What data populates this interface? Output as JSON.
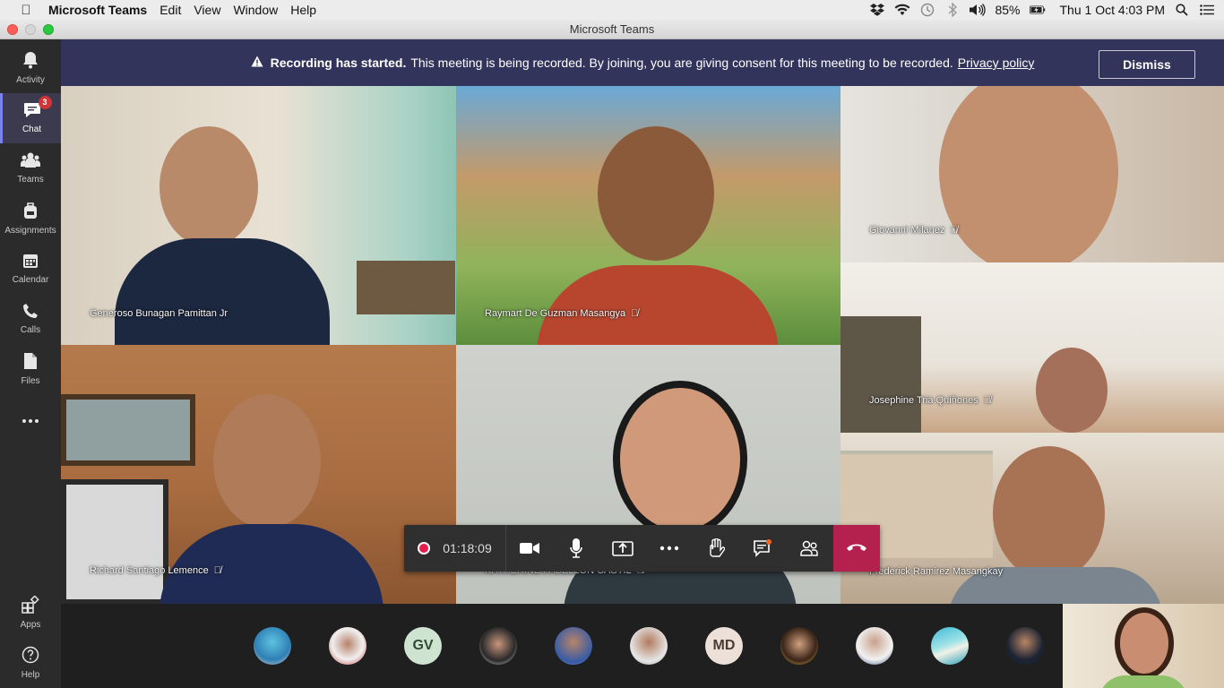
{
  "menubar": {
    "app_name": "Microsoft Teams",
    "menus": [
      "Edit",
      "View",
      "Window",
      "Help"
    ],
    "battery": "85%",
    "clock": "Thu 1 Oct  4:03 PM"
  },
  "window": {
    "title": "Microsoft Teams"
  },
  "rail": {
    "items": [
      {
        "label": "Activity",
        "icon": "bell-icon"
      },
      {
        "label": "Chat",
        "icon": "chat-icon",
        "badge": "3"
      },
      {
        "label": "Teams",
        "icon": "teams-icon"
      },
      {
        "label": "Assignments",
        "icon": "backpack-icon"
      },
      {
        "label": "Calendar",
        "icon": "calendar-icon"
      },
      {
        "label": "Calls",
        "icon": "phone-icon"
      },
      {
        "label": "Files",
        "icon": "file-icon"
      },
      {
        "label": "Apps",
        "icon": "apps-icon"
      },
      {
        "label": "Help",
        "icon": "help-icon"
      }
    ]
  },
  "banner": {
    "title": "Recording has started.",
    "message": "This meeting is being recorded. By joining, you are giving consent for this meeting to be recorded.",
    "link": "Privacy policy",
    "dismiss": "Dismiss"
  },
  "participants": [
    {
      "name": "Generoso Bunagan Pamittan Jr",
      "muted": false
    },
    {
      "name": "Raymart De Guzman Masangya",
      "muted": true
    },
    {
      "name": "Giovanni Milanez",
      "muted": true
    },
    {
      "name": "Josephine Tria Quiñones",
      "muted": true
    },
    {
      "name": "Richard Santiago Lemence",
      "muted": true
    },
    {
      "name": "KATHERINE FABELLON CASTIL",
      "muted": true
    },
    {
      "name": "Frederick Ramirez Masangkay",
      "muted": false
    }
  ],
  "controls": {
    "timer": "01:18:09"
  },
  "roster": {
    "initials": [
      "GV",
      "MD"
    ]
  },
  "colors": {
    "accent": "#7b83eb",
    "banner": "#33345c",
    "hangup": "#b5214f",
    "badge": "#d13438"
  }
}
